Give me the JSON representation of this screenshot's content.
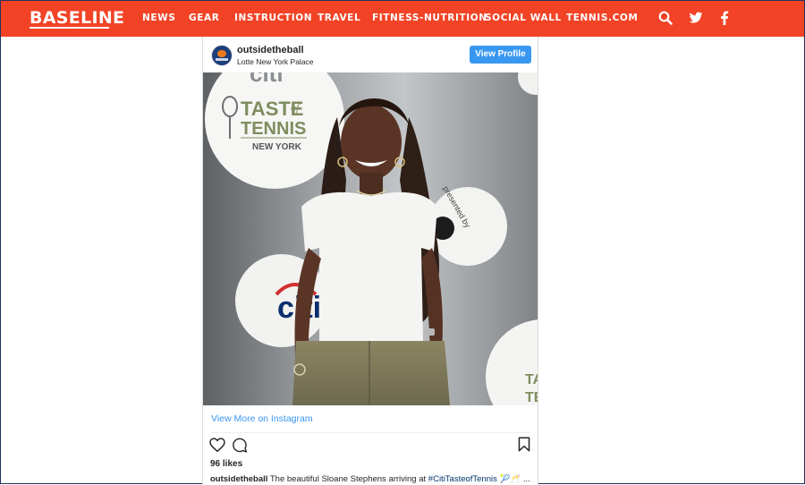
{
  "site": {
    "logo": "BASELINE"
  },
  "nav": {
    "items": [
      "NEWS",
      "GEAR",
      "INSTRUCTION",
      "TRAVEL",
      "FITNESS-NUTRITION",
      "SOCIAL WALL",
      "TENNIS.COM"
    ],
    "icons": [
      "search-icon",
      "twitter-icon",
      "facebook-icon"
    ]
  },
  "post": {
    "username": "outsidetheball",
    "location": "Lotte New York Palace",
    "view_profile": "View Profile",
    "view_more": "View More on Instagram",
    "likes": "96 likes",
    "caption_user": "outsidetheball",
    "caption_text": "The beautiful Sloane Stephens arriving at",
    "caption_tag": "#CitiTasteofTennis",
    "caption_tail": "🎾🥂 ...",
    "backdrop": {
      "brand_top": "citi",
      "taste": "TASTE",
      "of": "of",
      "tennis": "TENNIS",
      "city": "NEW YORK",
      "presented": "presented by",
      "citi_mid": "citi",
      "taste_right": "TA",
      "tennis_right": "TE"
    }
  },
  "colors": {
    "brand_red": "#f24326",
    "ig_blue": "#3897f0"
  }
}
